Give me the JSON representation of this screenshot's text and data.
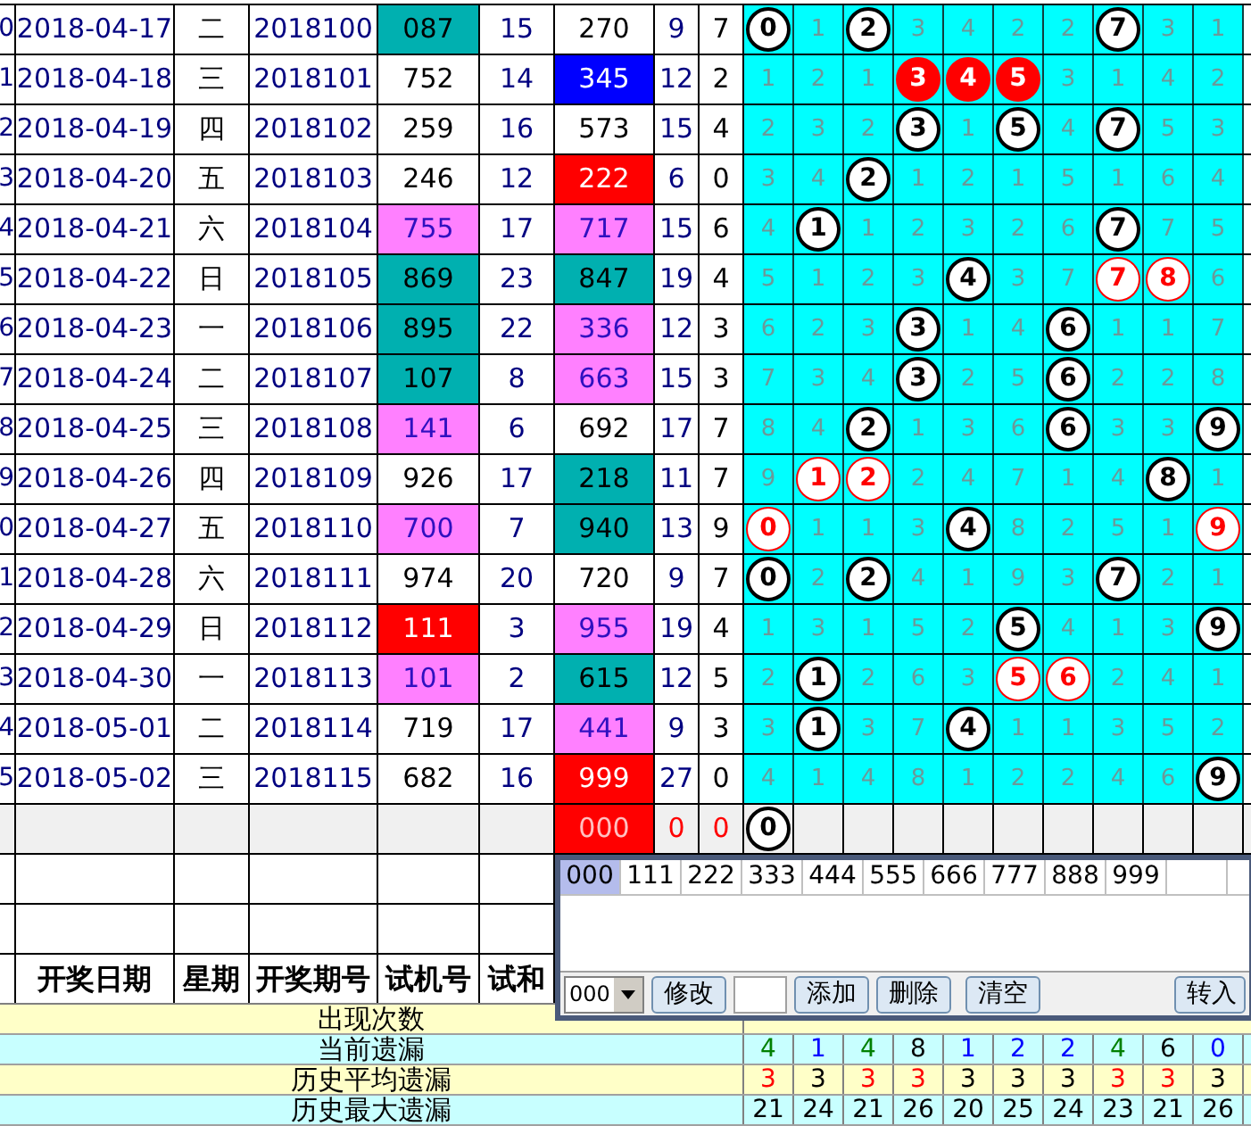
{
  "rows": [
    {
      "index": "0",
      "date": "2018-04-17",
      "weekday": "二",
      "period": "2018100",
      "trial": {
        "value": "087",
        "kind": "group6"
      },
      "trial_sum": "15",
      "number": {
        "value": "270",
        "kind": "plain"
      },
      "sum": "9",
      "span": "7",
      "digits": [
        {
          "value": "0",
          "kind": "hit"
        },
        {
          "value": "1",
          "kind": "miss"
        },
        {
          "value": "2",
          "kind": "hit"
        },
        {
          "value": "3",
          "kind": "miss"
        },
        {
          "value": "4",
          "kind": "miss"
        },
        {
          "value": "2",
          "kind": "miss"
        },
        {
          "value": "2",
          "kind": "miss"
        },
        {
          "value": "7",
          "kind": "hit"
        },
        {
          "value": "3",
          "kind": "miss"
        },
        {
          "value": "1",
          "kind": "miss"
        }
      ]
    },
    {
      "index": "1",
      "date": "2018-04-18",
      "weekday": "三",
      "period": "2018101",
      "trial": {
        "value": "752",
        "kind": "plain"
      },
      "trial_sum": "14",
      "number": {
        "value": "345",
        "kind": "straight"
      },
      "sum": "12",
      "span": "2",
      "digits": [
        {
          "value": "1",
          "kind": "miss"
        },
        {
          "value": "2",
          "kind": "miss"
        },
        {
          "value": "1",
          "kind": "miss"
        },
        {
          "value": "3",
          "kind": "triple"
        },
        {
          "value": "4",
          "kind": "triple"
        },
        {
          "value": "5",
          "kind": "triple"
        },
        {
          "value": "3",
          "kind": "miss"
        },
        {
          "value": "1",
          "kind": "miss"
        },
        {
          "value": "4",
          "kind": "miss"
        },
        {
          "value": "2",
          "kind": "miss"
        }
      ]
    },
    {
      "index": "2",
      "date": "2018-04-19",
      "weekday": "四",
      "period": "2018102",
      "trial": {
        "value": "259",
        "kind": "plain"
      },
      "trial_sum": "16",
      "number": {
        "value": "573",
        "kind": "plain"
      },
      "sum": "15",
      "span": "4",
      "digits": [
        {
          "value": "2",
          "kind": "miss"
        },
        {
          "value": "3",
          "kind": "miss"
        },
        {
          "value": "2",
          "kind": "miss"
        },
        {
          "value": "3",
          "kind": "hit"
        },
        {
          "value": "1",
          "kind": "miss"
        },
        {
          "value": "5",
          "kind": "hit"
        },
        {
          "value": "4",
          "kind": "miss"
        },
        {
          "value": "7",
          "kind": "hit"
        },
        {
          "value": "5",
          "kind": "miss"
        },
        {
          "value": "3",
          "kind": "miss"
        }
      ]
    },
    {
      "index": "3",
      "date": "2018-04-20",
      "weekday": "五",
      "period": "2018103",
      "trial": {
        "value": "246",
        "kind": "plain"
      },
      "trial_sum": "12",
      "number": {
        "value": "222",
        "kind": "leopard"
      },
      "sum": "6",
      "span": "0",
      "digits": [
        {
          "value": "3",
          "kind": "miss"
        },
        {
          "value": "4",
          "kind": "miss"
        },
        {
          "value": "2",
          "kind": "hit"
        },
        {
          "value": "1",
          "kind": "miss"
        },
        {
          "value": "2",
          "kind": "miss"
        },
        {
          "value": "1",
          "kind": "miss"
        },
        {
          "value": "5",
          "kind": "miss"
        },
        {
          "value": "1",
          "kind": "miss"
        },
        {
          "value": "6",
          "kind": "miss"
        },
        {
          "value": "4",
          "kind": "miss"
        }
      ]
    },
    {
      "index": "4",
      "date": "2018-04-21",
      "weekday": "六",
      "period": "2018104",
      "trial": {
        "value": "755",
        "kind": "group3"
      },
      "trial_sum": "17",
      "number": {
        "value": "717",
        "kind": "group3"
      },
      "sum": "15",
      "span": "6",
      "digits": [
        {
          "value": "4",
          "kind": "miss"
        },
        {
          "value": "1",
          "kind": "hit"
        },
        {
          "value": "1",
          "kind": "miss"
        },
        {
          "value": "2",
          "kind": "miss"
        },
        {
          "value": "3",
          "kind": "miss"
        },
        {
          "value": "2",
          "kind": "miss"
        },
        {
          "value": "6",
          "kind": "miss"
        },
        {
          "value": "7",
          "kind": "hit"
        },
        {
          "value": "7",
          "kind": "miss"
        },
        {
          "value": "5",
          "kind": "miss"
        }
      ]
    },
    {
      "index": "5",
      "date": "2018-04-22",
      "weekday": "日",
      "period": "2018105",
      "trial": {
        "value": "869",
        "kind": "group6"
      },
      "trial_sum": "23",
      "number": {
        "value": "847",
        "kind": "group6"
      },
      "sum": "19",
      "span": "4",
      "digits": [
        {
          "value": "5",
          "kind": "miss"
        },
        {
          "value": "1",
          "kind": "miss"
        },
        {
          "value": "2",
          "kind": "miss"
        },
        {
          "value": "3",
          "kind": "miss"
        },
        {
          "value": "4",
          "kind": "hit"
        },
        {
          "value": "3",
          "kind": "miss"
        },
        {
          "value": "7",
          "kind": "miss"
        },
        {
          "value": "7",
          "kind": "pair"
        },
        {
          "value": "8",
          "kind": "pair"
        },
        {
          "value": "6",
          "kind": "miss"
        }
      ]
    },
    {
      "index": "6",
      "date": "2018-04-23",
      "weekday": "一",
      "period": "2018106",
      "trial": {
        "value": "895",
        "kind": "group6"
      },
      "trial_sum": "22",
      "number": {
        "value": "336",
        "kind": "group3"
      },
      "sum": "12",
      "span": "3",
      "digits": [
        {
          "value": "6",
          "kind": "miss"
        },
        {
          "value": "2",
          "kind": "miss"
        },
        {
          "value": "3",
          "kind": "miss"
        },
        {
          "value": "3",
          "kind": "hit"
        },
        {
          "value": "1",
          "kind": "miss"
        },
        {
          "value": "4",
          "kind": "miss"
        },
        {
          "value": "6",
          "kind": "hit"
        },
        {
          "value": "1",
          "kind": "miss"
        },
        {
          "value": "1",
          "kind": "miss"
        },
        {
          "value": "7",
          "kind": "miss"
        }
      ]
    },
    {
      "index": "7",
      "date": "2018-04-24",
      "weekday": "二",
      "period": "2018107",
      "trial": {
        "value": "107",
        "kind": "group6"
      },
      "trial_sum": "8",
      "number": {
        "value": "663",
        "kind": "group3"
      },
      "sum": "15",
      "span": "3",
      "digits": [
        {
          "value": "7",
          "kind": "miss"
        },
        {
          "value": "3",
          "kind": "miss"
        },
        {
          "value": "4",
          "kind": "miss"
        },
        {
          "value": "3",
          "kind": "hit"
        },
        {
          "value": "2",
          "kind": "miss"
        },
        {
          "value": "5",
          "kind": "miss"
        },
        {
          "value": "6",
          "kind": "hit"
        },
        {
          "value": "2",
          "kind": "miss"
        },
        {
          "value": "2",
          "kind": "miss"
        },
        {
          "value": "8",
          "kind": "miss"
        }
      ]
    },
    {
      "index": "8",
      "date": "2018-04-25",
      "weekday": "三",
      "period": "2018108",
      "trial": {
        "value": "141",
        "kind": "group3"
      },
      "trial_sum": "6",
      "number": {
        "value": "692",
        "kind": "plain"
      },
      "sum": "17",
      "span": "7",
      "digits": [
        {
          "value": "8",
          "kind": "miss"
        },
        {
          "value": "4",
          "kind": "miss"
        },
        {
          "value": "2",
          "kind": "hit"
        },
        {
          "value": "1",
          "kind": "miss"
        },
        {
          "value": "3",
          "kind": "miss"
        },
        {
          "value": "6",
          "kind": "miss"
        },
        {
          "value": "6",
          "kind": "hit"
        },
        {
          "value": "3",
          "kind": "miss"
        },
        {
          "value": "3",
          "kind": "miss"
        },
        {
          "value": "9",
          "kind": "hit"
        }
      ]
    },
    {
      "index": "9",
      "date": "2018-04-26",
      "weekday": "四",
      "period": "2018109",
      "trial": {
        "value": "926",
        "kind": "plain"
      },
      "trial_sum": "17",
      "number": {
        "value": "218",
        "kind": "group6"
      },
      "sum": "11",
      "span": "7",
      "digits": [
        {
          "value": "9",
          "kind": "miss"
        },
        {
          "value": "1",
          "kind": "pair"
        },
        {
          "value": "2",
          "kind": "pair"
        },
        {
          "value": "2",
          "kind": "miss"
        },
        {
          "value": "4",
          "kind": "miss"
        },
        {
          "value": "7",
          "kind": "miss"
        },
        {
          "value": "1",
          "kind": "miss"
        },
        {
          "value": "4",
          "kind": "miss"
        },
        {
          "value": "8",
          "kind": "hit"
        },
        {
          "value": "1",
          "kind": "miss"
        }
      ]
    },
    {
      "index": "0",
      "date": "2018-04-27",
      "weekday": "五",
      "period": "2018110",
      "trial": {
        "value": "700",
        "kind": "group3"
      },
      "trial_sum": "7",
      "number": {
        "value": "940",
        "kind": "group6"
      },
      "sum": "13",
      "span": "9",
      "digits": [
        {
          "value": "0",
          "kind": "pair"
        },
        {
          "value": "1",
          "kind": "miss"
        },
        {
          "value": "1",
          "kind": "miss"
        },
        {
          "value": "3",
          "kind": "miss"
        },
        {
          "value": "4",
          "kind": "hit"
        },
        {
          "value": "8",
          "kind": "miss"
        },
        {
          "value": "2",
          "kind": "miss"
        },
        {
          "value": "5",
          "kind": "miss"
        },
        {
          "value": "1",
          "kind": "miss"
        },
        {
          "value": "9",
          "kind": "pair"
        }
      ]
    },
    {
      "index": "1",
      "date": "2018-04-28",
      "weekday": "六",
      "period": "2018111",
      "trial": {
        "value": "974",
        "kind": "plain"
      },
      "trial_sum": "20",
      "number": {
        "value": "720",
        "kind": "plain"
      },
      "sum": "9",
      "span": "7",
      "digits": [
        {
          "value": "0",
          "kind": "hit"
        },
        {
          "value": "2",
          "kind": "miss"
        },
        {
          "value": "2",
          "kind": "hit"
        },
        {
          "value": "4",
          "kind": "miss"
        },
        {
          "value": "1",
          "kind": "miss"
        },
        {
          "value": "9",
          "kind": "miss"
        },
        {
          "value": "3",
          "kind": "miss"
        },
        {
          "value": "7",
          "kind": "hit"
        },
        {
          "value": "2",
          "kind": "miss"
        },
        {
          "value": "1",
          "kind": "miss"
        }
      ]
    },
    {
      "index": "2",
      "date": "2018-04-29",
      "weekday": "日",
      "period": "2018112",
      "trial": {
        "value": "111",
        "kind": "leopard"
      },
      "trial_sum": "3",
      "number": {
        "value": "955",
        "kind": "group3"
      },
      "sum": "19",
      "span": "4",
      "digits": [
        {
          "value": "1",
          "kind": "miss"
        },
        {
          "value": "3",
          "kind": "miss"
        },
        {
          "value": "1",
          "kind": "miss"
        },
        {
          "value": "5",
          "kind": "miss"
        },
        {
          "value": "2",
          "kind": "miss"
        },
        {
          "value": "5",
          "kind": "hit"
        },
        {
          "value": "4",
          "kind": "miss"
        },
        {
          "value": "1",
          "kind": "miss"
        },
        {
          "value": "3",
          "kind": "miss"
        },
        {
          "value": "9",
          "kind": "hit"
        }
      ]
    },
    {
      "index": "3",
      "date": "2018-04-30",
      "weekday": "一",
      "period": "2018113",
      "trial": {
        "value": "101",
        "kind": "group3"
      },
      "trial_sum": "2",
      "number": {
        "value": "615",
        "kind": "group6"
      },
      "sum": "12",
      "span": "5",
      "digits": [
        {
          "value": "2",
          "kind": "miss"
        },
        {
          "value": "1",
          "kind": "hit"
        },
        {
          "value": "2",
          "kind": "miss"
        },
        {
          "value": "6",
          "kind": "miss"
        },
        {
          "value": "3",
          "kind": "miss"
        },
        {
          "value": "5",
          "kind": "pair"
        },
        {
          "value": "6",
          "kind": "pair"
        },
        {
          "value": "2",
          "kind": "miss"
        },
        {
          "value": "4",
          "kind": "miss"
        },
        {
          "value": "1",
          "kind": "miss"
        }
      ]
    },
    {
      "index": "4",
      "date": "2018-05-01",
      "weekday": "二",
      "period": "2018114",
      "trial": {
        "value": "719",
        "kind": "plain"
      },
      "trial_sum": "17",
      "number": {
        "value": "441",
        "kind": "group3"
      },
      "sum": "9",
      "span": "3",
      "digits": [
        {
          "value": "3",
          "kind": "miss"
        },
        {
          "value": "1",
          "kind": "hit"
        },
        {
          "value": "3",
          "kind": "miss"
        },
        {
          "value": "7",
          "kind": "miss"
        },
        {
          "value": "4",
          "kind": "hit"
        },
        {
          "value": "1",
          "kind": "miss"
        },
        {
          "value": "1",
          "kind": "miss"
        },
        {
          "value": "3",
          "kind": "miss"
        },
        {
          "value": "5",
          "kind": "miss"
        },
        {
          "value": "2",
          "kind": "miss"
        }
      ]
    },
    {
      "index": "5",
      "date": "2018-05-02",
      "weekday": "三",
      "period": "2018115",
      "trial": {
        "value": "682",
        "kind": "plain"
      },
      "trial_sum": "16",
      "number": {
        "value": "999",
        "kind": "leopard"
      },
      "sum": "27",
      "span": "0",
      "digits": [
        {
          "value": "4",
          "kind": "miss"
        },
        {
          "value": "1",
          "kind": "miss"
        },
        {
          "value": "4",
          "kind": "miss"
        },
        {
          "value": "8",
          "kind": "miss"
        },
        {
          "value": "1",
          "kind": "miss"
        },
        {
          "value": "2",
          "kind": "miss"
        },
        {
          "value": "2",
          "kind": "miss"
        },
        {
          "value": "4",
          "kind": "miss"
        },
        {
          "value": "6",
          "kind": "miss"
        },
        {
          "value": "9",
          "kind": "hit"
        }
      ]
    }
  ],
  "trial_row": {
    "number": "000",
    "sum": "0",
    "span": "0",
    "digits": [
      {
        "value": "0",
        "kind": "hit"
      }
    ]
  },
  "header": [
    "开奖日期",
    "星期",
    "开奖期号",
    "试机号",
    "试和"
  ],
  "summary": [
    {
      "label": "出现次数"
    },
    {
      "label": "当前遗漏",
      "values": [
        {
          "value": "4",
          "color": "#008000"
        },
        {
          "value": "1",
          "color": "#0000ff"
        },
        {
          "value": "4",
          "color": "#008000"
        },
        {
          "value": "8",
          "color": "#000000"
        },
        {
          "value": "1",
          "color": "#0000ff"
        },
        {
          "value": "2",
          "color": "#0000ff"
        },
        {
          "value": "2",
          "color": "#0000ff"
        },
        {
          "value": "4",
          "color": "#008000"
        },
        {
          "value": "6",
          "color": "#000000"
        },
        {
          "value": "0",
          "color": "#0000ff"
        }
      ]
    },
    {
      "label": "历史平均遗漏",
      "values": [
        {
          "value": "3",
          "color": "#ff0000"
        },
        {
          "value": "3",
          "color": "#000000"
        },
        {
          "value": "3",
          "color": "#ff0000"
        },
        {
          "value": "3",
          "color": "#ff0000"
        },
        {
          "value": "3",
          "color": "#000000"
        },
        {
          "value": "3",
          "color": "#000000"
        },
        {
          "value": "3",
          "color": "#000000"
        },
        {
          "value": "3",
          "color": "#ff0000"
        },
        {
          "value": "3",
          "color": "#ff0000"
        },
        {
          "value": "3",
          "color": "#000000"
        }
      ]
    },
    {
      "label": "历史最大遗漏",
      "values": [
        {
          "value": "21",
          "color": "#000000"
        },
        {
          "value": "24",
          "color": "#000000"
        },
        {
          "value": "21",
          "color": "#000000"
        },
        {
          "value": "26",
          "color": "#000000"
        },
        {
          "value": "20",
          "color": "#000000"
        },
        {
          "value": "25",
          "color": "#000000"
        },
        {
          "value": "24",
          "color": "#000000"
        },
        {
          "value": "23",
          "color": "#000000"
        },
        {
          "value": "21",
          "color": "#000000"
        },
        {
          "value": "26",
          "color": "#000000"
        }
      ]
    }
  ],
  "popup": {
    "tabs": [
      {
        "label": "000",
        "selected": true
      },
      {
        "label": "111",
        "selected": false
      },
      {
        "label": "222",
        "selected": false
      },
      {
        "label": "333",
        "selected": false
      },
      {
        "label": "444",
        "selected": false
      },
      {
        "label": "555",
        "selected": false
      },
      {
        "label": "666",
        "selected": false
      },
      {
        "label": "777",
        "selected": false
      },
      {
        "label": "888",
        "selected": false
      },
      {
        "label": "999",
        "selected": false
      }
    ],
    "select": "000",
    "edit_button": "修改",
    "buttons": [
      "添加",
      "删除",
      "清空"
    ],
    "transfer_button": "转入"
  }
}
